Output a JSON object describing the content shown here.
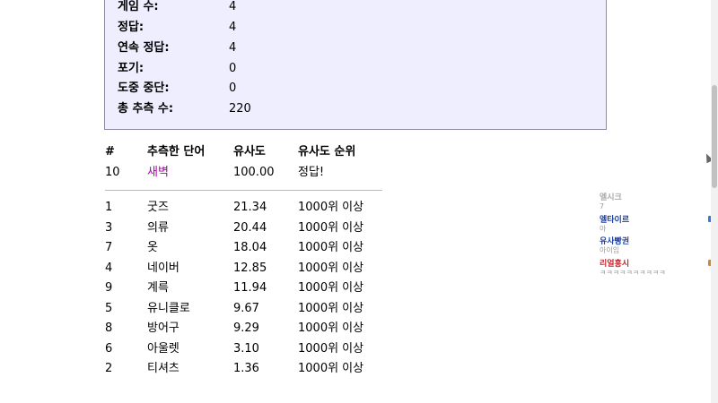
{
  "stats": [
    {
      "label": "게임 수:",
      "value": "4"
    },
    {
      "label": "정답:",
      "value": "4"
    },
    {
      "label": "연속 정답:",
      "value": "4"
    },
    {
      "label": "포기:",
      "value": "0"
    },
    {
      "label": "도중 중단:",
      "value": "0"
    },
    {
      "label": "총 추측 수:",
      "value": "220"
    }
  ],
  "table": {
    "headers": [
      "#",
      "추측한 단어",
      "유사도",
      "유사도 순위"
    ],
    "answer_row": {
      "num": "10",
      "word": "새벽",
      "similarity": "100.00",
      "rank": "정답!"
    },
    "rows": [
      {
        "num": "1",
        "word": "굿즈",
        "similarity": "21.34",
        "rank": "1000위 이상"
      },
      {
        "num": "3",
        "word": "의류",
        "similarity": "20.44",
        "rank": "1000위 이상"
      },
      {
        "num": "7",
        "word": "옷",
        "similarity": "18.04",
        "rank": "1000위 이상"
      },
      {
        "num": "4",
        "word": "네이버",
        "similarity": "12.85",
        "rank": "1000위 이상"
      },
      {
        "num": "9",
        "word": "계륵",
        "similarity": "11.94",
        "rank": "1000위 이상"
      },
      {
        "num": "5",
        "word": "유니클로",
        "similarity": "9.67",
        "rank": "1000위 이상"
      },
      {
        "num": "8",
        "word": "방어구",
        "similarity": "9.29",
        "rank": "1000위 이상"
      },
      {
        "num": "6",
        "word": "아울렛",
        "similarity": "3.10",
        "rank": "1000위 이상"
      },
      {
        "num": "2",
        "word": "티셔츠",
        "similarity": "1.36",
        "rank": "1000위 이상"
      }
    ]
  },
  "ads": [
    {
      "title": "엘시크",
      "sub": "7",
      "color": "#aaaaaa"
    },
    {
      "title": "엘타이르",
      "sub": "아",
      "color": "#1a3fa6"
    },
    {
      "title": "유사빵권",
      "sub": "아이임",
      "color": "#1a3fa6"
    },
    {
      "title": "리얼홍시",
      "sub": "ㅋㅋㅋㅋㅋㅋㅋㅋㅋㅋ",
      "color": "#c0262a"
    }
  ],
  "colors": {
    "answer_word": "#b000b0",
    "stats_bg": "#eeeeff"
  }
}
